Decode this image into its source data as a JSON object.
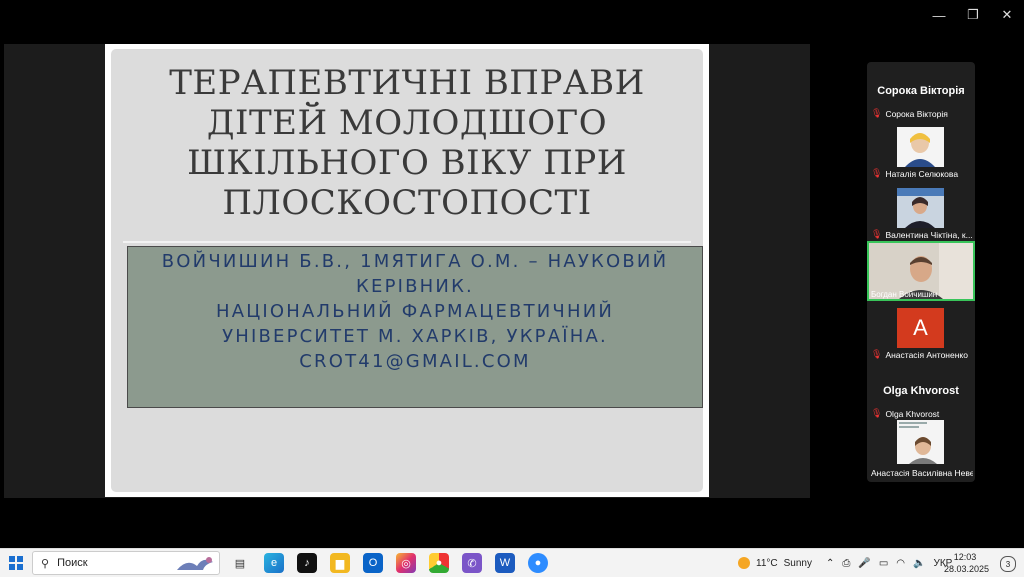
{
  "window": {
    "minimize": "—",
    "restore": "❐",
    "close": "✕"
  },
  "slide": {
    "title_lines": [
      "ТЕРАПЕВТИЧНІ ВПРАВИ",
      "ДІТЕЙ МОЛОДШОГО",
      "ШКІЛЬНОГО ВІКУ ПРИ",
      "ПЛОСКОСТОПОСТІ"
    ],
    "info_lines": [
      "ВОЙЧИШИН Б.В., 1МЯТИГА О.М. – НАУКОВИЙ",
      "КЕРІВНИК.",
      "НАЦІОНАЛЬНИЙ ФАРМАЦЕВТИЧНИЙ",
      "УНІВЕРСИТЕТ М. ХАРКІВ, УКРАЇНА.",
      "CROT41@GMAIL.COM"
    ]
  },
  "participants": [
    {
      "heading": "Сорока Вікторія",
      "name": "Сорока Вікторія",
      "type": "name-only"
    },
    {
      "name": "Наталія Селюкова",
      "type": "video"
    },
    {
      "name": "Валентина Чіктіна, к...",
      "type": "video"
    },
    {
      "name": "Богдан Войчишин",
      "type": "video-active"
    },
    {
      "avatar_letter": "A",
      "name": "Анастасія Антоненко",
      "type": "avatar"
    },
    {
      "heading": "Olga Khvorost",
      "name": "Olga Khvorost",
      "type": "name-only"
    },
    {
      "name": "Анастасія Василівна Неве...",
      "type": "video"
    }
  ],
  "taskbar": {
    "search_placeholder": "Поиск",
    "weather_temp": "11°C",
    "weather_desc": "Sunny",
    "language": "УКР",
    "time": "12:03",
    "date": "28.03.2025",
    "notifications": "3",
    "apps": [
      "task-view",
      "edge",
      "tiktok",
      "file-explorer",
      "outlook",
      "instagram",
      "chrome",
      "viber",
      "word",
      "zoom"
    ]
  },
  "colors": {
    "slide_bg": "#dcdcdc",
    "info_box_bg": "#8c9a8e",
    "info_text": "#223b6b",
    "active_speaker_border": "#39c45a",
    "avatar_bg": "#d33a1e"
  }
}
